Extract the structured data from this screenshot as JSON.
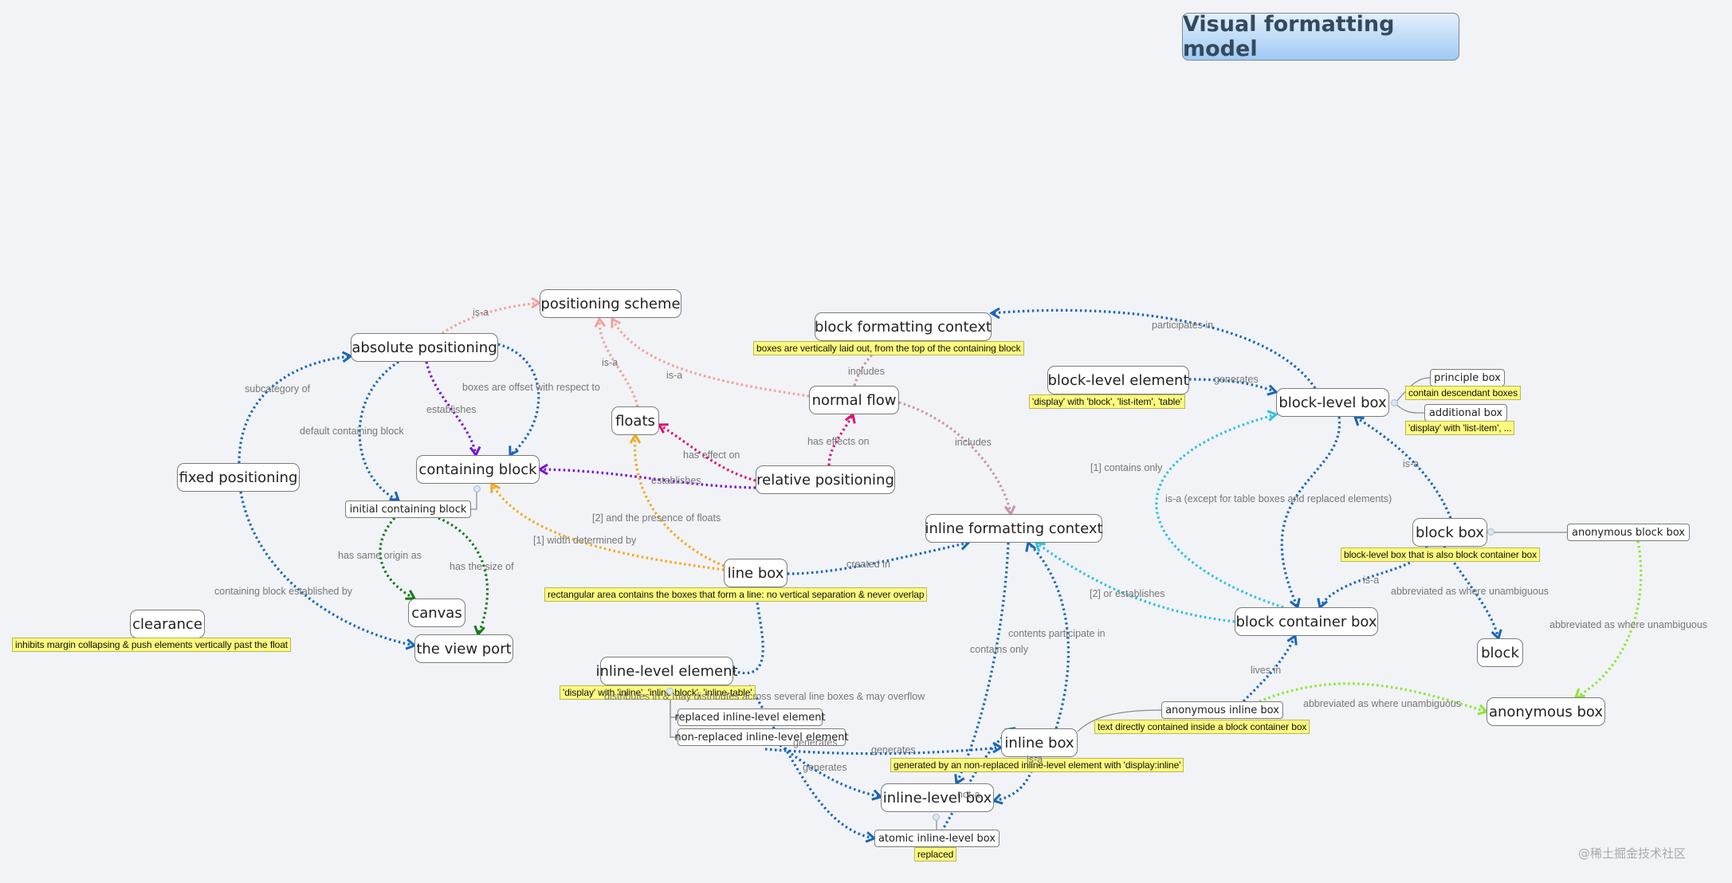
{
  "title": "Visual formatting model",
  "watermark": "@稀土掘金技术社区",
  "colors": {
    "background": "#f1f3f7",
    "note": "#fcfa7e",
    "salmon": "#f2a19a",
    "blue": "#1767b8",
    "purple": "#7a12d6",
    "magenta": "#de1074",
    "orange": "#f4a91c",
    "green": "#137a16",
    "cyan": "#2fc0dc",
    "lime": "#8fe632",
    "mauve": "#c992b0"
  },
  "nodes": {
    "positioning_scheme": "positioning scheme",
    "absolute_positioning": "absolute positioning",
    "fixed_positioning": "fixed positioning",
    "containing_block": "containing block",
    "initial_containing_block": "initial containing block",
    "canvas": "canvas",
    "view_port": "the view port",
    "clearance": "clearance",
    "floats": "floats",
    "relative_positioning": "relative positioning",
    "normal_flow": "normal flow",
    "block_formatting_context": "block formatting context",
    "block_level_element": "block-level element",
    "block_level_box": "block-level box",
    "principle_box": "principle box",
    "additional_box": "additional box",
    "inline_formatting_context": "inline formatting context",
    "line_box": "line box",
    "block_box": "block box",
    "anonymous_block_box": "anonymous block box",
    "block_container_box": "block container box",
    "block": "block",
    "anonymous_box": "anonymous box",
    "anonymous_inline_box": "anonymous inline box",
    "inline_level_element": "inline-level element",
    "replaced_inline_level_element": "replaced inline-level element",
    "non_replaced_inline_level_element": "non-replaced inline-level element",
    "inline_box": "inline box",
    "inline_level_box": "inline-level box",
    "atomic_inline_level_box": "atomic inline-level box"
  },
  "notes": {
    "clearance": "inhibits margin collapsing & push elements vertically past the float",
    "block_formatting_context": "boxes are vertically laid out, from the top of the containing block",
    "block_level_element": "'display' with 'block', 'list-item', 'table'",
    "principle_box": "contain descendant boxes",
    "additional_box": "'display' with 'list-item', ...",
    "block_box": "block-level box that is also block container box",
    "line_box": "rectangular area contains the boxes that form a line: no vertical separation & never overlap",
    "inline_level_element": "'display' with 'inline', 'inline-block', 'inline-table'",
    "anonymous_inline_box": "text directly contained inside a block container box",
    "inline_box": "generated by an non-replaced inline-level element with 'display:inline'",
    "atomic_inline_level_box": "replaced"
  },
  "edge_labels": {
    "abs_isa": "is-a",
    "subcategory_of": "subcategory of",
    "offset_wrt": "boxes are offset with respect to",
    "abs_establishes": "establishes",
    "default_cb": "default containing block",
    "floats_isa": "is-a",
    "normal_isa": "is-a",
    "includes_bfc": "includes",
    "participates_in": "participates in",
    "generates_blb": "generates",
    "has_effect_on": "has effect on",
    "has_effects_on": "has effects on",
    "rel_establishes": "establishes",
    "includes_ifc": "includes",
    "contains_only_1": "[1] contains only",
    "isa_except": "is-a (except for table boxes and replaced elements)",
    "blockbox_isa": "is-a",
    "presence_floats": "[2] and the presence of floats",
    "width_determined": "[1] width determined by",
    "same_origin": "has same origin as",
    "size_of": "has the size of",
    "cb_established_by": "containing block established by",
    "created_in": "created in",
    "or_establishes": "[2] or establishes",
    "bb_isa": "is-a",
    "abbrev_block": "abbreviated as where unambiguous",
    "abbrev_anon": "abbreviated as where unambiguous",
    "contents_participate": "contents participate in",
    "contains_only": "contains only",
    "lives_in": "lives in",
    "abbrev_anon2": "abbreviated as where unambiguous",
    "distributes": "distributes in & may distributes across several line boxes & may overflow",
    "generates_1": "generates",
    "generates_2": "generates",
    "generates_3": "generates",
    "inline_isa": "is-a",
    "not_a": "not-a"
  }
}
